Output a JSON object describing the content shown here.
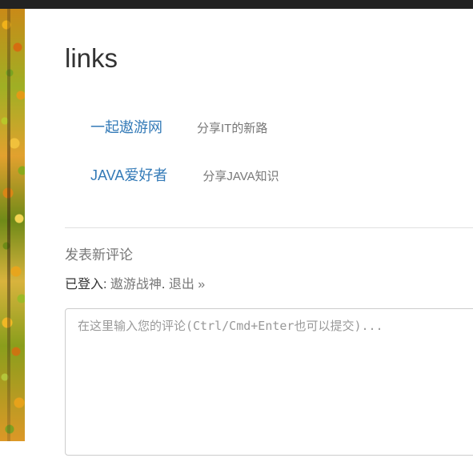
{
  "header": {
    "title": "links"
  },
  "links": [
    {
      "name": "一起遨游网",
      "description": "分享IT的新路"
    },
    {
      "name": "JAVA爱好者",
      "description": "分享JAVA知识"
    }
  ],
  "comments": {
    "heading": "发表新评论",
    "logged_in_label": "已登入: ",
    "username": "遨游战神",
    "separator": ". ",
    "logout_label": "退出 »",
    "placeholder": "在这里输入您的评论(Ctrl/Cmd+Enter也可以提交)..."
  },
  "colors": {
    "link": "#337ab7",
    "muted_text": "#777777",
    "title_text": "#333333",
    "top_bar": "#222222"
  }
}
